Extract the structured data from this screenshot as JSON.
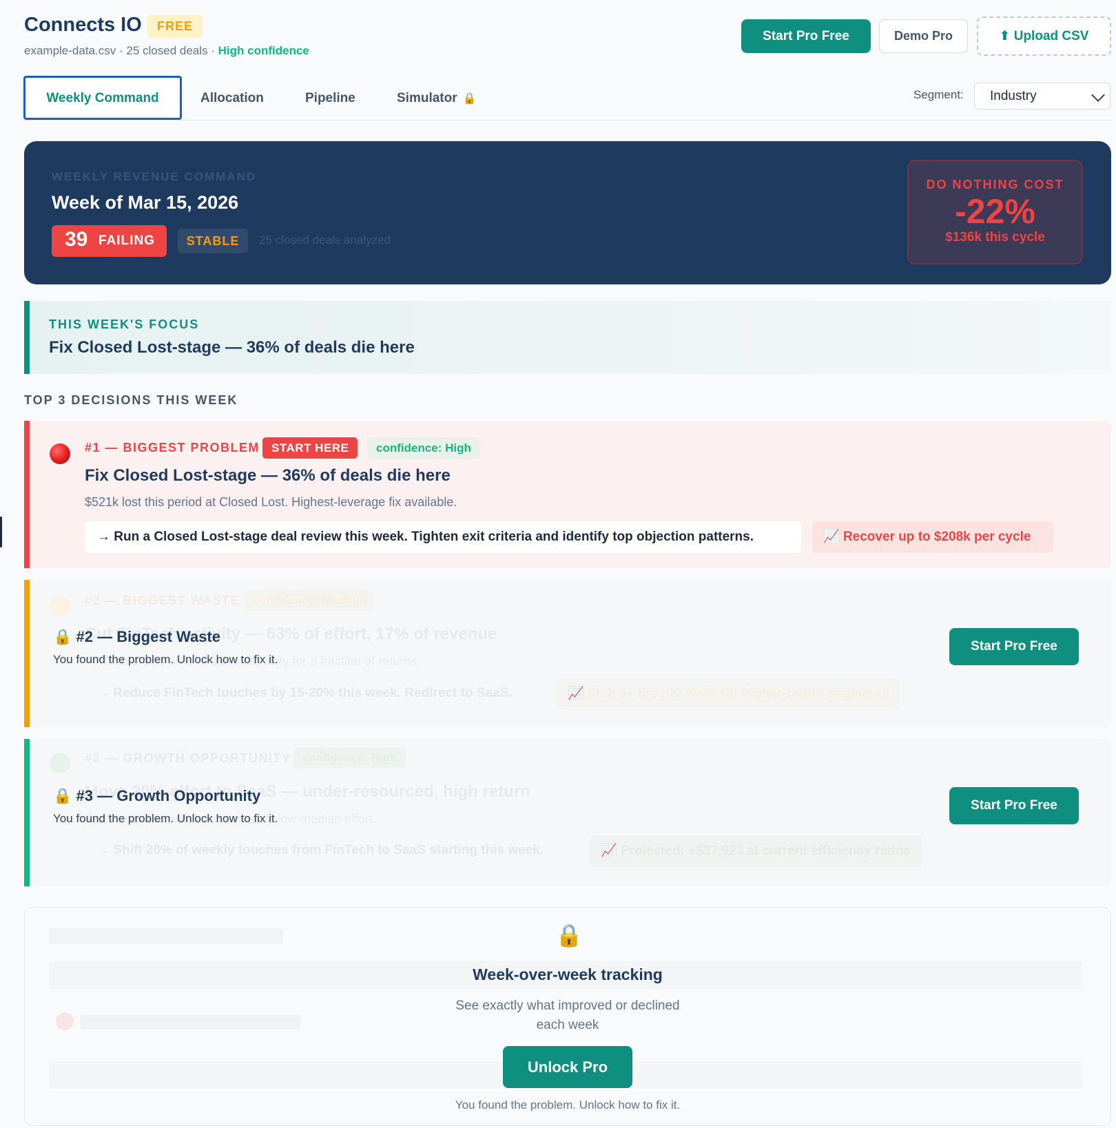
{
  "header": {
    "app_title": "Connects IO",
    "plan_badge": "FREE",
    "file_name": "example-data.csv",
    "deal_count": "25 closed deals",
    "separator": "·",
    "confidence": "High confidence",
    "start_pro_label": "Start Pro Free",
    "demo_pro_label": "Demo Pro",
    "upload_label": "Upload CSV",
    "upload_icon": "⬆"
  },
  "tabs": [
    {
      "label": "Weekly Command",
      "active": true
    },
    {
      "label": "Allocation"
    },
    {
      "label": "Pipeline"
    },
    {
      "label": "Simulator",
      "locked": true
    }
  ],
  "segment": {
    "label": "Segment:",
    "value": "Industry"
  },
  "hero": {
    "eyebrow": "WEEKLY REVENUE COMMAND",
    "week": "Week of Mar 15, 2026",
    "score": "39",
    "status": "FAILING",
    "trend": "STABLE",
    "analyzed": "25 closed deals analyzed",
    "cost_title": "DO NOTHING COST",
    "cost_pct": "-22%",
    "cost_amount": "$136k this cycle"
  },
  "focus": {
    "eyebrow": "THIS WEEK'S FOCUS",
    "title": "Fix Closed Lost-stage — 36% of deals die here"
  },
  "decisions_title": "TOP 3 DECISIONS THIS WEEK",
  "decision1": {
    "eyebrow": "#1 — BIGGEST PROBLEM",
    "badge": "START HERE",
    "confidence": "confidence: High",
    "title": "Fix Closed Lost-stage — 36% of deals die here",
    "desc": "$521k lost this period at Closed Lost. Highest-leverage fix available.",
    "action": "→ Run a Closed Lost-stage deal review this week. Tighten exit criteria and identify top objection patterns.",
    "impact": "📈 Recover up to $208k per cycle"
  },
  "decision2": {
    "ghost_eyebrow": "#2 — BIGGEST WASTE",
    "ghost_conf": "confidence: Medium",
    "ghost_title": "Cut FinTech activity — 63% of effort, 17% of revenue",
    "ghost_desc": "FinTech drains 63% of sales capacity for a fraction of returns.",
    "ghost_action": "→ Reduce FinTech touches by 15-20% this week. Redirect to SaaS.",
    "ghost_impact": "📈 Free 9+ hrs per week for higher-return segments",
    "lock_icon": "🔒",
    "lock_title": "#2 — Biggest Waste",
    "lock_sub": "You found the problem. Unlock how to fix it.",
    "button": "Start Pro Free"
  },
  "decision3": {
    "ghost_eyebrow": "#3 — GROWTH OPPORTUNITY",
    "ghost_conf": "confidence: High",
    "ghost_title": "Move 20% effort to SaaS — under-resourced, high return",
    "ghost_desc": "SaaS converts well but receives below-median effort.",
    "ghost_action": "→ Shift 20% of weekly touches from FinTech to SaaS starting this week.",
    "ghost_impact": "📈 Projected: +$37,923 at current efficiency ratios",
    "lock_icon": "🔒",
    "lock_title": "#3 — Growth Opportunity",
    "lock_sub": "You found the problem. Unlock how to fix it.",
    "button": "Start Pro Free"
  },
  "week_over_week": {
    "lock_icon": "🔒",
    "title": "Week-over-week tracking",
    "subtitle": "See exactly what improved or declined each week",
    "button": "Unlock Pro",
    "footer": "You found the problem. Unlock how to fix it."
  },
  "colors": {
    "teal": "#0f8f80",
    "navy": "#1e3a5f",
    "red": "#ef4444",
    "amber": "#f59e0b",
    "green": "#10b981"
  }
}
